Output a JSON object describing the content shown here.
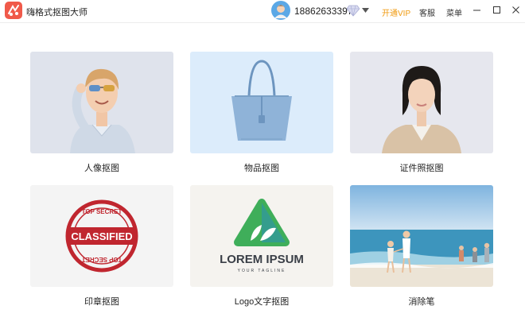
{
  "app": {
    "title": "嗨格式抠图大师"
  },
  "user": {
    "phone": "18862633397"
  },
  "header": {
    "vip_label": "开通VIP",
    "service_label": "客服",
    "menu_label": "菜单"
  },
  "tools": [
    {
      "label": "人像抠图"
    },
    {
      "label": "物品抠图"
    },
    {
      "label": "证件照抠图"
    },
    {
      "label": "印章抠图"
    },
    {
      "label": "Logo文字抠图"
    },
    {
      "label": "消除笔"
    }
  ],
  "thumbnails": {
    "stamp": {
      "top_text": "TOP SECRET",
      "main_text": "CLASSIFIED",
      "bottom_text": "TOP SECRET"
    },
    "logo": {
      "title": "LOREM IPSUM",
      "tagline": "YOUR TAGLINE"
    }
  },
  "colors": {
    "vip": "#f09a0f",
    "brand": "#f05a4a",
    "stamp_red": "#c0262f",
    "logo_green": "#3fae5a"
  }
}
